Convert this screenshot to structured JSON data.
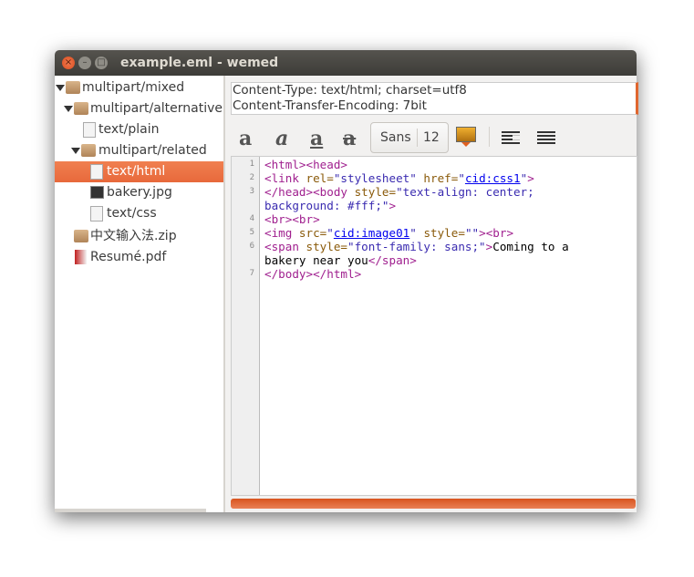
{
  "window": {
    "title": "example.eml - wemed"
  },
  "tree": [
    {
      "label": "multipart/mixed",
      "icon": "package-icon",
      "expanded": true
    },
    {
      "label": "multipart/alternative",
      "icon": "package-icon",
      "expanded": true
    },
    {
      "label": "text/plain",
      "icon": "text-file-icon"
    },
    {
      "label": "multipart/related",
      "icon": "package-icon",
      "expanded": true
    },
    {
      "label": "text/html",
      "icon": "html-file-icon",
      "selected": true
    },
    {
      "label": "bakery.jpg",
      "icon": "image-file-icon"
    },
    {
      "label": "text/css",
      "icon": "css-file-icon"
    },
    {
      "label": "中文输入法.zip",
      "icon": "package-icon"
    },
    {
      "label": "Resumé.pdf",
      "icon": "pdf-file-icon"
    }
  ],
  "headers": [
    "Content-Type: text/html; charset=utf8",
    "Content-Transfer-Encoding: 7bit"
  ],
  "toolbar": {
    "bold": "a",
    "italic": "a",
    "underline": "a",
    "strike": "a",
    "font_name": "Sans",
    "font_size": "12"
  },
  "editor": {
    "line_numbers": [
      "1",
      "2",
      "3",
      "4",
      "5",
      "6",
      "7"
    ]
  },
  "colors": {
    "accent": "#e8693b",
    "tag": "#a0208f",
    "attribute": "#8a5a0a",
    "string": "#3a2bb0"
  },
  "bottom_bar": {
    "fill_percent": 100
  }
}
